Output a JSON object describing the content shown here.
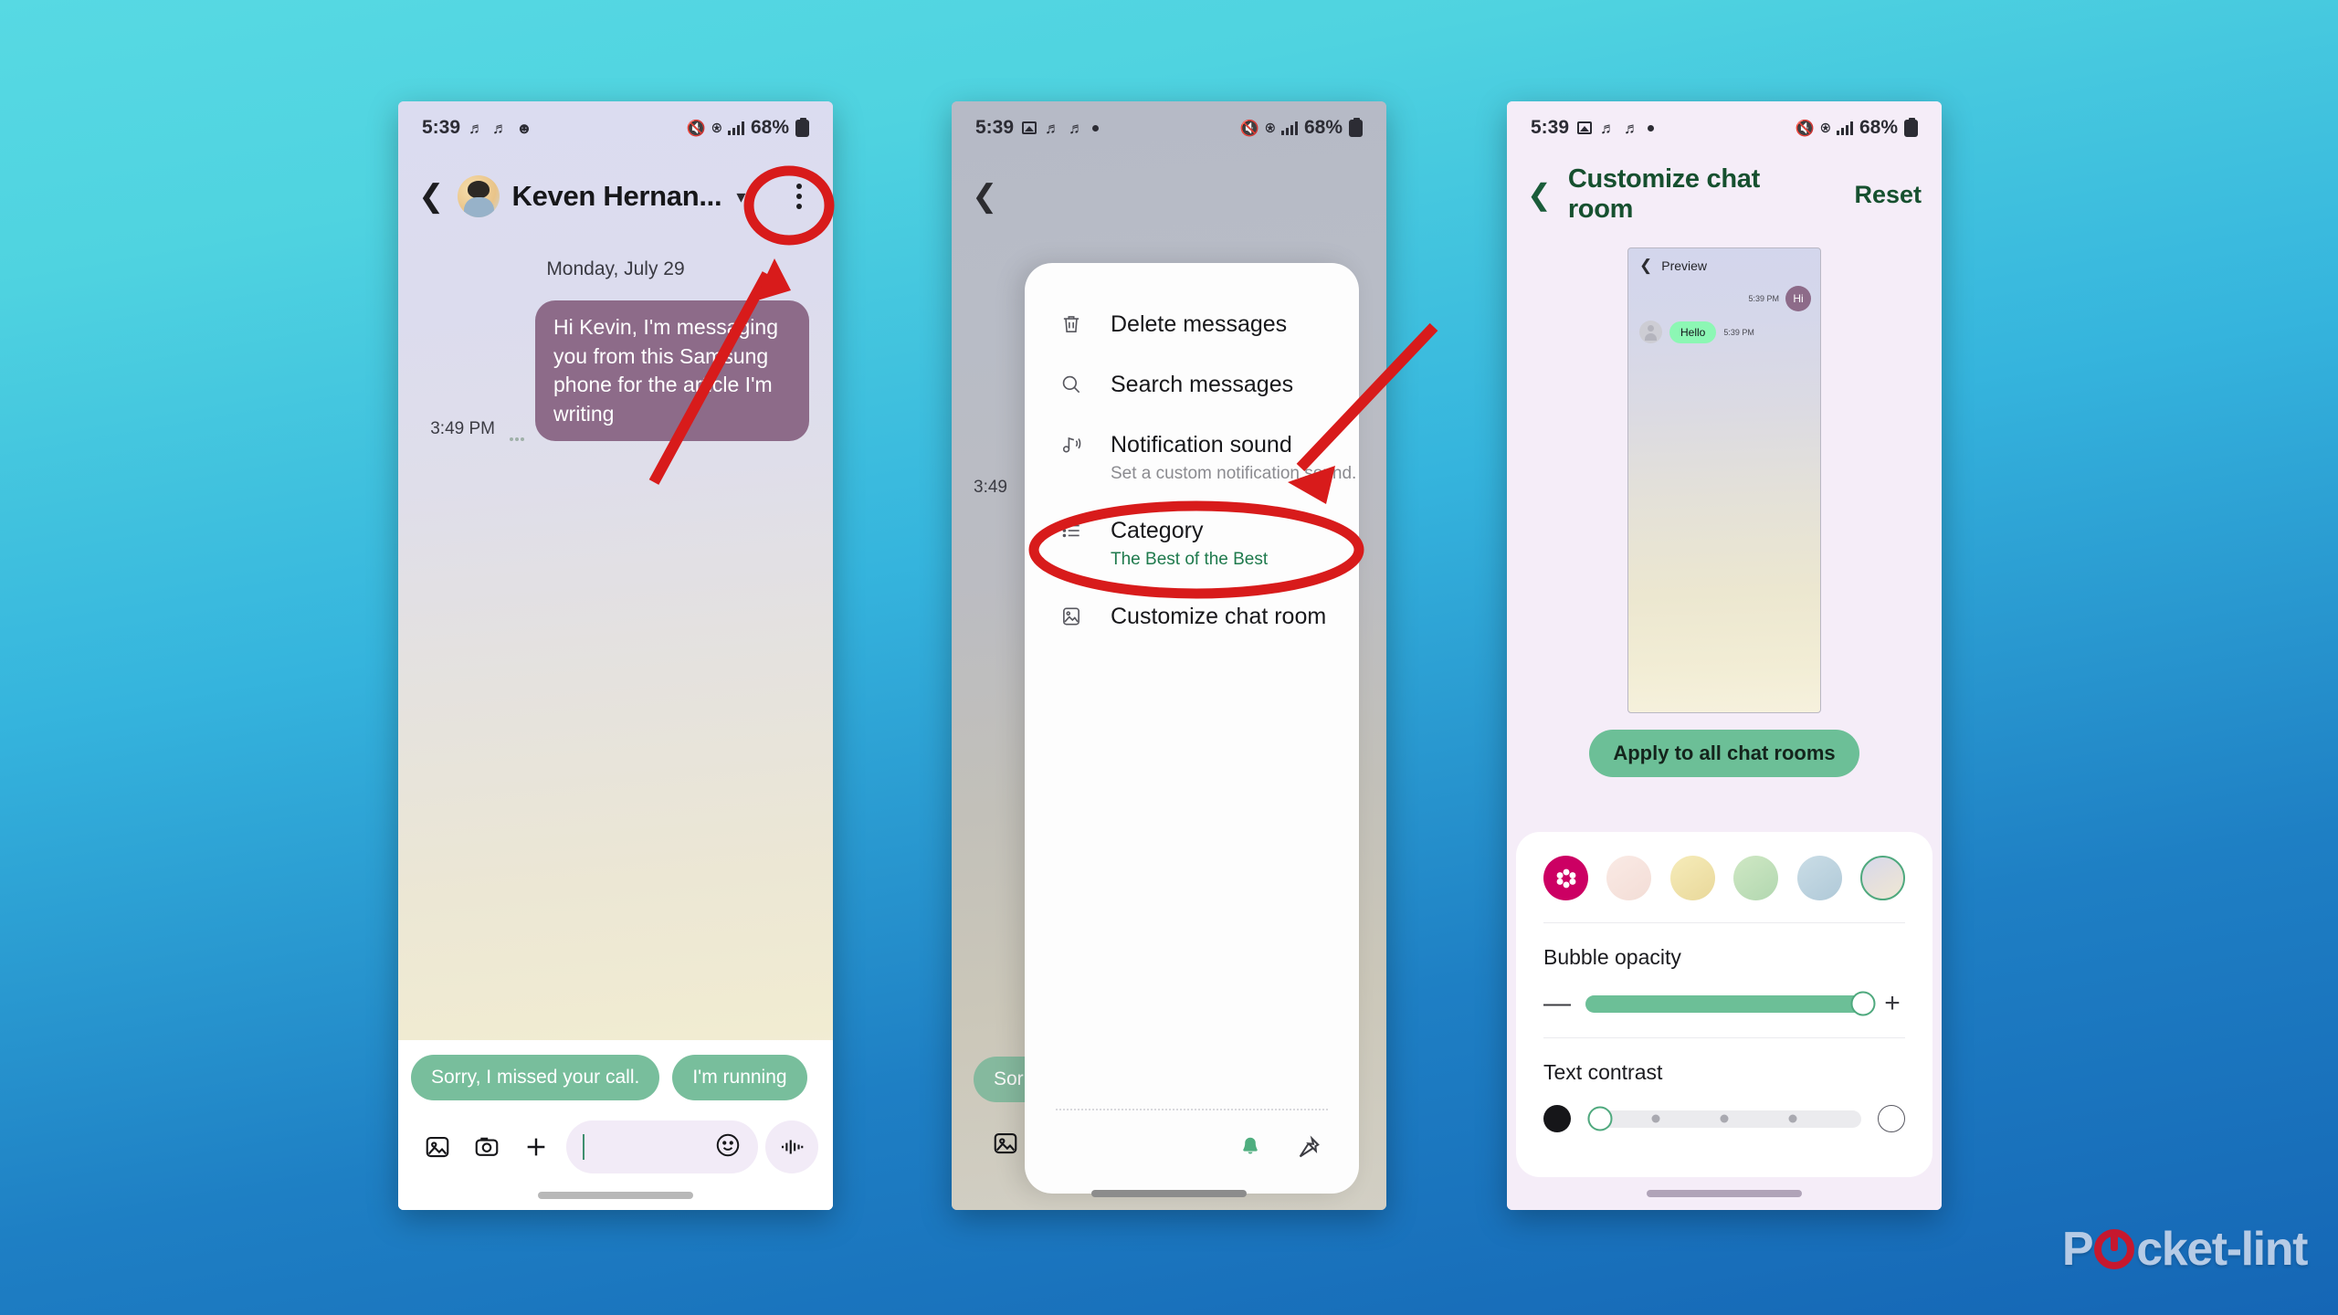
{
  "background": {
    "top_color": "#57d9e3",
    "bottom_color": "#1566b5"
  },
  "watermark": {
    "text_before": "P",
    "text_after": "cket-lint",
    "accent": "#c6182e"
  },
  "phone1": {
    "statusbar": {
      "time": "5:39",
      "battery": "68%",
      "icons": [
        "mute-icon",
        "vibrate-icon",
        "profile-icon",
        "signal-icon",
        "wifi-icon"
      ]
    },
    "header": {
      "contact_name": "Keven Hernan...",
      "back_icon": "chevron-left-icon",
      "caret_icon": "chevron-down-icon",
      "menu_icon": "kebab-menu-icon"
    },
    "conversation": {
      "day_stamp": "Monday, July 29",
      "messages": [
        {
          "side": "outgoing",
          "time": "3:49 PM",
          "text": "Hi Kevin, I'm messaging you from this Samsung phone for the article I'm writing"
        }
      ]
    },
    "suggestions": [
      "Sorry, I missed your call.",
      "I'm running"
    ],
    "composer": {
      "placeholder": "",
      "value": "",
      "icons": [
        "gallery-icon",
        "camera-icon",
        "plus-icon",
        "emoji-icon",
        "voice-icon",
        "gear-icon"
      ]
    }
  },
  "phone2": {
    "statusbar": {
      "time": "5:39",
      "battery": "68%"
    },
    "ghost": {
      "chip": "Sorr",
      "msgtime": "3:49"
    },
    "menu": {
      "items": [
        {
          "icon": "trash-icon",
          "label": "Delete messages",
          "sub": ""
        },
        {
          "icon": "search-icon",
          "label": "Search messages",
          "sub": ""
        },
        {
          "icon": "notification-sound-icon",
          "label": "Notification sound",
          "sub": "Set a custom notification sound."
        },
        {
          "icon": "list-icon",
          "label": "Category",
          "sub": "The Best of the Best",
          "sub_color": "green"
        },
        {
          "icon": "image-frame-icon",
          "label": "Customize chat room",
          "sub": ""
        }
      ],
      "footer_icons": [
        "bell-icon",
        "pin-icon"
      ]
    }
  },
  "phone3": {
    "statusbar": {
      "time": "5:39",
      "battery": "68%"
    },
    "header": {
      "back_icon": "chevron-left-icon",
      "title": "Customize chat room",
      "reset": "Reset"
    },
    "preview": {
      "back_icon": "chevron-left-icon",
      "title": "Preview",
      "messages": [
        {
          "side": "outgoing",
          "text": "Hi",
          "time": "5:39 PM"
        },
        {
          "side": "incoming",
          "text": "Hello",
          "time": "5:39 PM"
        }
      ]
    },
    "apply_button": "Apply to all chat rooms",
    "swatches": [
      {
        "name": "custom-flower",
        "color": "#cc0063",
        "selected": false
      },
      {
        "name": "pink",
        "color": "#f6e3de",
        "selected": false
      },
      {
        "name": "yellow",
        "color": "#efdfab",
        "selected": false
      },
      {
        "name": "green",
        "color": "#bfdfbb",
        "selected": false
      },
      {
        "name": "blue",
        "color": "#bed3de",
        "selected": false
      },
      {
        "name": "gradient",
        "color": "#dcd9e4",
        "selected": true
      }
    ],
    "bubble_opacity": {
      "label": "Bubble opacity",
      "value": 100,
      "minus": "—",
      "plus": "+"
    },
    "text_contrast": {
      "label": "Text contrast",
      "value": 0,
      "ticks": 3
    }
  }
}
